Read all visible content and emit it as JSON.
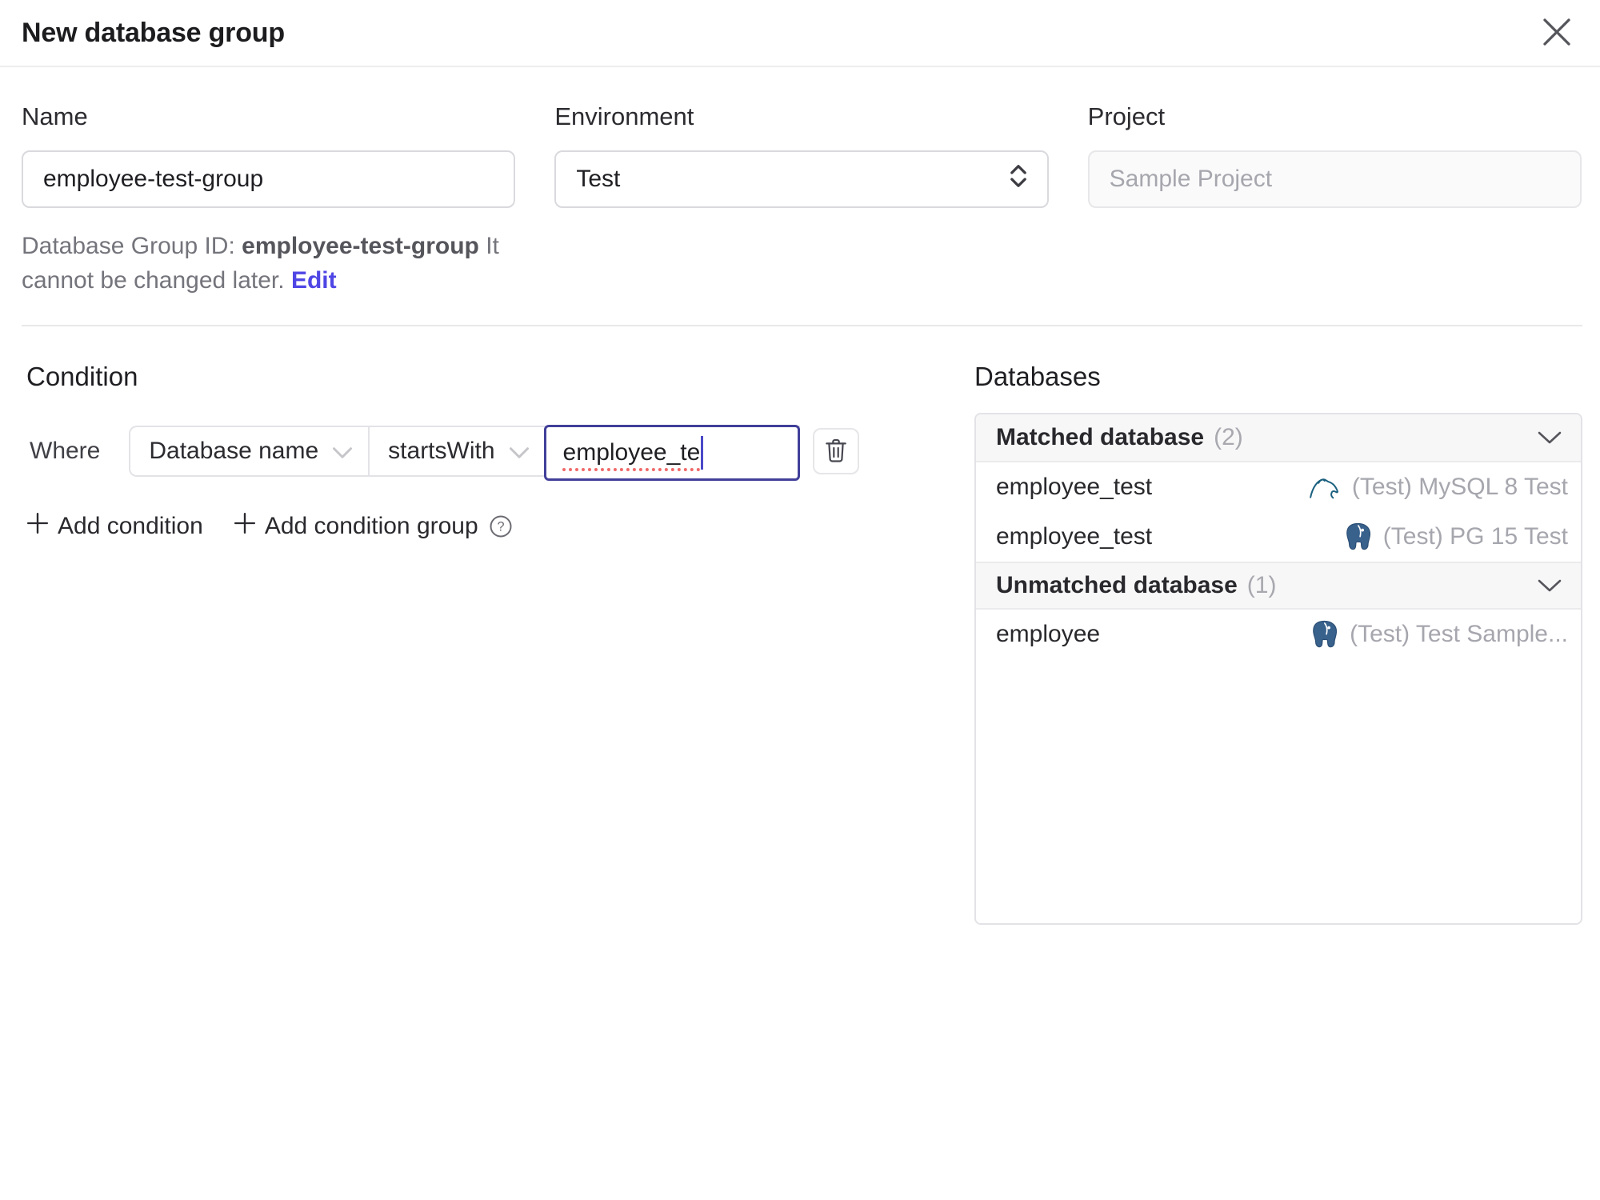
{
  "dialog": {
    "title": "New database group"
  },
  "form": {
    "name": {
      "label": "Name",
      "value": "employee-test-group"
    },
    "environment": {
      "label": "Environment",
      "value": "Test"
    },
    "project": {
      "label": "Project",
      "placeholder": "Sample Project"
    },
    "helper": {
      "prefix": "Database Group ID: ",
      "id": "employee-test-group",
      "suffix": " It cannot be changed later. ",
      "edit_link": "Edit"
    }
  },
  "condition": {
    "heading": "Condition",
    "where_label": "Where",
    "field": "Database name",
    "operator": "startsWith",
    "value": "employee_te",
    "add_condition_label": "Add condition",
    "add_condition_group_label": "Add condition group"
  },
  "databases": {
    "heading": "Databases",
    "groups": [
      {
        "title": "Matched database",
        "count": "(2)",
        "rows": [
          {
            "name": "employee_test",
            "engine": "mysql-icon",
            "instance": "(Test) MySQL 8 Test"
          },
          {
            "name": "employee_test",
            "engine": "postgres-icon",
            "instance": "(Test) PG 15 Test"
          }
        ]
      },
      {
        "title": "Unmatched database",
        "count": "(1)",
        "rows": [
          {
            "name": "employee",
            "engine": "postgres-icon",
            "instance": "(Test) Test Sample..."
          }
        ]
      }
    ]
  },
  "colors": {
    "accent_link": "#4f46e5",
    "focus_border": "#413f99",
    "spellcheck_red": "#f06a6a",
    "mysql": "#1b607f",
    "postgres": "#38618c",
    "panel_header_bg": "#f7f7f8",
    "border": "#e3e3e7"
  }
}
